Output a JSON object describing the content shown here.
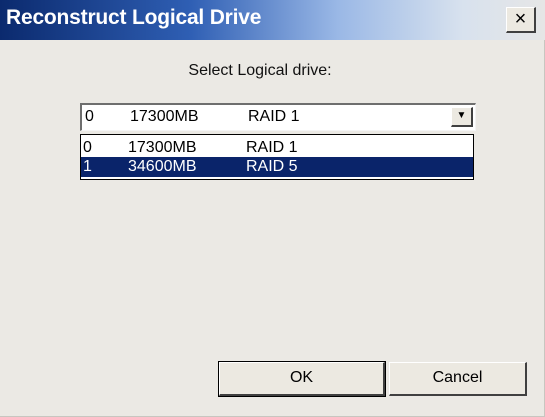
{
  "window": {
    "title": "Reconstruct Logical Drive",
    "close_label": "×"
  },
  "prompt": "Select Logical drive:",
  "combo": {
    "selected": {
      "id": "0",
      "size": "17300MB",
      "raid": "RAID 1"
    },
    "arrow_icon": "▼"
  },
  "list": [
    {
      "id": "0",
      "size": "17300MB",
      "raid": "RAID 1",
      "highlighted": false
    },
    {
      "id": "1",
      "size": "34600MB",
      "raid": "RAID 5",
      "highlighted": true
    }
  ],
  "buttons": {
    "ok": "OK",
    "cancel": "Cancel"
  },
  "colors": {
    "title_gradient_start": "#0b2a6e",
    "selection_bg": "#0a246a",
    "dialog_bg": "#ebe9e4"
  }
}
